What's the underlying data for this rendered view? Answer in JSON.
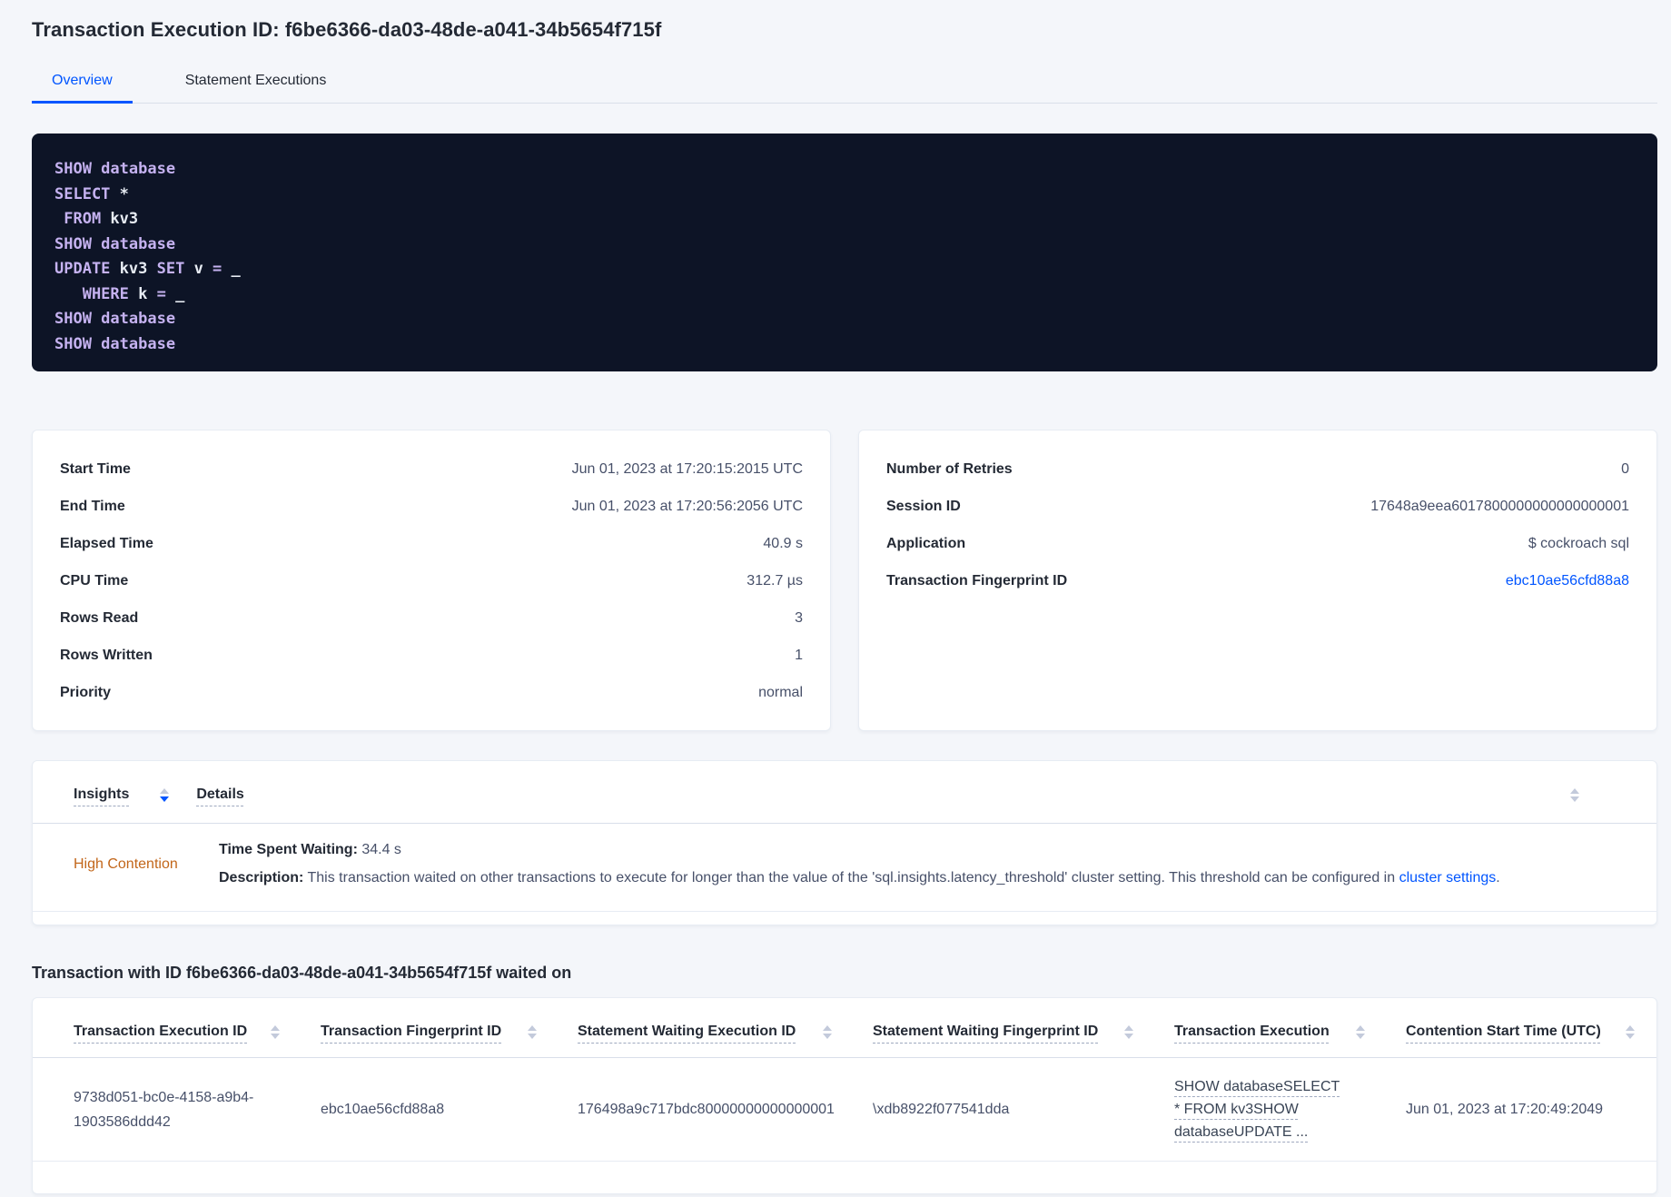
{
  "colors": {
    "accent_blue": "#0055ff",
    "insight_orange": "#c2661a",
    "code_bg": "#0d1426",
    "code_keyword": "#c5b2f0",
    "code_plain": "#e7ecf3"
  },
  "title": "Transaction Execution ID: f6be6366-da03-48de-a041-34b5654f715f",
  "tabs": {
    "overview": "Overview",
    "statement_executions": "Statement Executions"
  },
  "sql_lines": [
    [
      "SHOW database"
    ],
    [
      "SELECT",
      " *"
    ],
    [
      " FROM",
      " kv3"
    ],
    [
      "SHOW database"
    ],
    [
      "UPDATE",
      " kv3 ",
      "SET",
      " v ",
      "=",
      " _"
    ],
    [
      "   WHERE",
      " k ",
      "=",
      " _"
    ],
    [
      "SHOW database"
    ],
    [
      "SHOW database"
    ]
  ],
  "details_left": {
    "rows": [
      {
        "label": "Start Time",
        "value": "Jun 01, 2023 at 17:20:15:2015 UTC"
      },
      {
        "label": "End Time",
        "value": "Jun 01, 2023 at 17:20:56:2056 UTC"
      },
      {
        "label": "Elapsed Time",
        "value": "40.9 s"
      },
      {
        "label": "CPU Time",
        "value": "312.7 µs"
      },
      {
        "label": "Rows Read",
        "value": "3"
      },
      {
        "label": "Rows Written",
        "value": "1"
      },
      {
        "label": "Priority",
        "value": "normal"
      }
    ]
  },
  "details_right": {
    "rows": [
      {
        "label": "Number of Retries",
        "value": "0"
      },
      {
        "label": "Session ID",
        "value": "17648a9eea6017800000000000000001"
      },
      {
        "label": "Application",
        "value": "$ cockroach sql"
      },
      {
        "label": "Transaction Fingerprint ID",
        "value": "ebc10ae56cfd88a8"
      }
    ]
  },
  "insights": {
    "col_insight": "Insights",
    "col_details": "Details",
    "insight_label": "High Contention",
    "waiting_label": "Time Spent Waiting:",
    "waiting_value": " 34.4 s",
    "description_label": "Description:",
    "description_text": " This transaction waited on other transactions to execute for longer than the value of the 'sql.insights.latency_threshold' cluster setting. This threshold can be configured in ",
    "description_link": "cluster settings",
    "description_period": "."
  },
  "waited_on": {
    "heading": "Transaction with ID f6be6366-da03-48de-a041-34b5654f715f waited on",
    "columns": [
      "Transaction Execution ID",
      "Transaction Fingerprint ID",
      "Statement Waiting Execution ID",
      "Statement Waiting Fingerprint ID",
      "Transaction Execution",
      "Contention Start Time (UTC)"
    ],
    "row": {
      "transaction_execution_id": "9738d051-bc0e-4158-a9b4-1903586ddd42",
      "transaction_fingerprint_id": "ebc10ae56cfd88a8",
      "statement_waiting_execution_id": "176498a9c717bdc80000000000000001",
      "statement_waiting_fingerprint_id": "\\xdb8922f077541dda",
      "transaction_execution": "SHOW databaseSELECT * FROM kv3SHOW databaseUPDATE ...",
      "contention_start_time": "Jun 01, 2023 at 17:20:49:2049"
    }
  }
}
